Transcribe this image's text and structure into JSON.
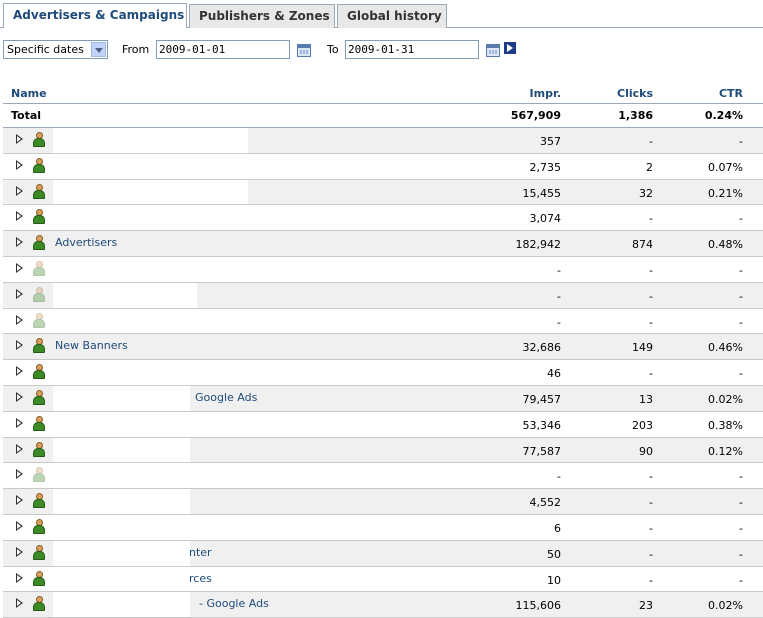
{
  "tabs": [
    {
      "label": "Advertisers & Campaigns",
      "active": true
    },
    {
      "label": "Publishers & Zones",
      "active": false
    },
    {
      "label": "Global history",
      "active": false
    }
  ],
  "filter": {
    "period_selected": "Specific dates",
    "from_label": "From",
    "from_value": "2009-01-01",
    "to_label": "To",
    "to_value": "2009-01-31"
  },
  "columns": {
    "name": "Name",
    "impr": "Impr.",
    "clicks": "Clicks",
    "ctr": "CTR"
  },
  "total": {
    "name": "Total",
    "impr": "567,909",
    "clicks": "1,386",
    "ctr": "0.24%"
  },
  "rows": [
    {
      "name": "",
      "impr": "357",
      "clicks": "-",
      "ctr": "-",
      "active": true
    },
    {
      "name": "",
      "impr": "2,735",
      "clicks": "2",
      "ctr": "0.07%",
      "active": true
    },
    {
      "name": "",
      "impr": "15,455",
      "clicks": "32",
      "ctr": "0.21%",
      "active": true
    },
    {
      "name": "",
      "impr": "3,074",
      "clicks": "-",
      "ctr": "-",
      "active": true
    },
    {
      "name": "Advertisers",
      "impr": "182,942",
      "clicks": "874",
      "ctr": "0.48%",
      "active": true
    },
    {
      "name": "",
      "impr": "-",
      "clicks": "-",
      "ctr": "-",
      "active": false
    },
    {
      "name": "",
      "impr": "-",
      "clicks": "-",
      "ctr": "-",
      "active": false
    },
    {
      "name": "",
      "impr": "-",
      "clicks": "-",
      "ctr": "-",
      "active": false
    },
    {
      "name": "New Banners",
      "impr": "32,686",
      "clicks": "149",
      "ctr": "0.46%",
      "active": true
    },
    {
      "name": "",
      "impr": "46",
      "clicks": "-",
      "ctr": "-",
      "active": true
    },
    {
      "name": "Google Ads",
      "impr": "79,457",
      "clicks": "13",
      "ctr": "0.02%",
      "active": true
    },
    {
      "name": "",
      "impr": "53,346",
      "clicks": "203",
      "ctr": "0.38%",
      "active": true
    },
    {
      "name": "",
      "impr": "77,587",
      "clicks": "90",
      "ctr": "0.12%",
      "active": true
    },
    {
      "name": "",
      "impr": "-",
      "clicks": "-",
      "ctr": "-",
      "active": false
    },
    {
      "name": "",
      "impr": "4,552",
      "clicks": "-",
      "ctr": "-",
      "active": true
    },
    {
      "name": "",
      "impr": "6",
      "clicks": "-",
      "ctr": "-",
      "active": true
    },
    {
      "name": "nter",
      "impr": "50",
      "clicks": "-",
      "ctr": "-",
      "active": true
    },
    {
      "name": "rces",
      "impr": "10",
      "clicks": "-",
      "ctr": "-",
      "active": true
    },
    {
      "name": "- Google Ads",
      "impr": "115,606",
      "clicks": "23",
      "ctr": "0.02%",
      "active": true
    }
  ],
  "colors": {
    "link": "#1f4b7a",
    "alt_row": "#f0f0f0",
    "border": "#9aa8b8"
  }
}
